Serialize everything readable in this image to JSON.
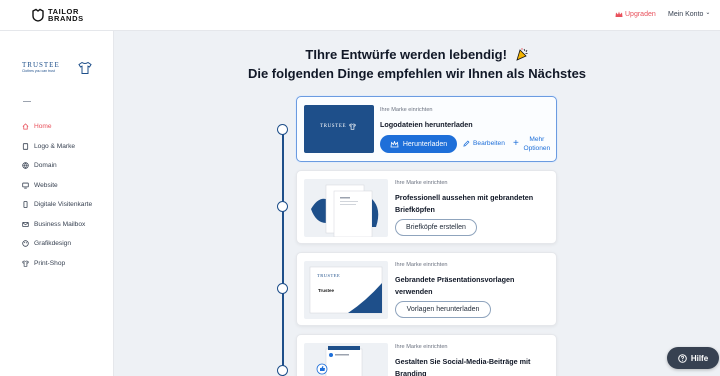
{
  "header": {
    "logo_line1": "TAILOR",
    "logo_line2": "BRANDS",
    "upgrade_label": "Upgraden",
    "account_label": "Mein Konto",
    "account_caret": "⌄"
  },
  "sidebar": {
    "brand_name": "TRUSTEE",
    "brand_tagline": "Clothes you can trust",
    "items": [
      {
        "label": "Home",
        "icon": "home-icon",
        "active": true
      },
      {
        "label": "Logo & Marke",
        "icon": "document-icon"
      },
      {
        "label": "Domain",
        "icon": "globe-icon"
      },
      {
        "label": "Website",
        "icon": "monitor-icon"
      },
      {
        "label": "Digitale Visitenkarte",
        "icon": "phone-icon"
      },
      {
        "label": "Business Mailbox",
        "icon": "mail-icon"
      },
      {
        "label": "Grafikdesign",
        "icon": "palette-icon"
      },
      {
        "label": "Print-Shop",
        "icon": "shirt-icon"
      }
    ]
  },
  "main": {
    "heading_line1": "TIhre Entwürfe werden lebendig!",
    "heading_line2": "Die folgenden Dinge empfehlen wir Ihnen als Nächstes"
  },
  "cards": [
    {
      "eyebrow": "Ihre Marke einrichten",
      "title": "Logodateien herunterladen",
      "primary_label": "Herunterladen",
      "edit_label": "Bearbeiten",
      "more_label": "Mehr Optionen",
      "thumb_brand": "TRUSTEE"
    },
    {
      "eyebrow": "Ihre Marke einrichten",
      "title": "Professionell aussehen mit gebrandeten Briefköpfen",
      "button_label": "Briefköpfe erstellen"
    },
    {
      "eyebrow": "Ihre Marke einrichten",
      "title": "Gebrandete Präsentationsvorlagen verwenden",
      "button_label": "Vorlagen herunterladen",
      "thumb_brand": "TRUSTEE",
      "thumb_label": "Trustee"
    },
    {
      "eyebrow": "Ihre Marke einrichten",
      "title": "Gestalten Sie Social-Media-Beiträge mit Branding"
    }
  ],
  "help_label": "Hilfe",
  "colors": {
    "accent_blue": "#1e6fd9",
    "navy": "#1e4f8a",
    "upgrade_red": "#e8505b"
  }
}
